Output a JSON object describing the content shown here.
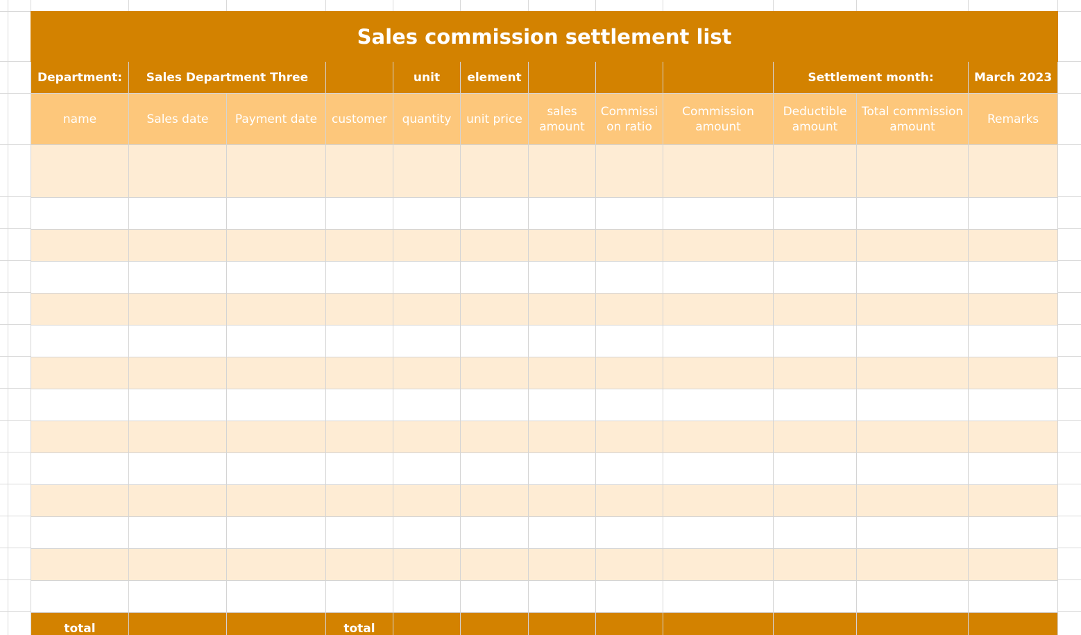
{
  "sheet": {
    "title": "Sales commission settlement list",
    "info_row": {
      "department_label": "Department:",
      "department_value": "Sales Department Three",
      "unit_label": "unit",
      "element_label": "element",
      "settlement_label": "Settlement month:",
      "settlement_value": "March 2023"
    },
    "columns": [
      "name",
      "Sales date",
      "Payment date",
      "customer",
      "quantity",
      "unit price",
      "sales amount",
      "Commissi on ratio",
      "Commission amount",
      "Deductible amount",
      "Total commission amount",
      "Remarks"
    ],
    "total_row": {
      "label_1": "total",
      "label_2": "total"
    }
  },
  "colors": {
    "header_dark": "#d38200",
    "header_light": "#fdc77b",
    "row_tint": "#feecd4",
    "gridline": "#d9d9d9"
  }
}
